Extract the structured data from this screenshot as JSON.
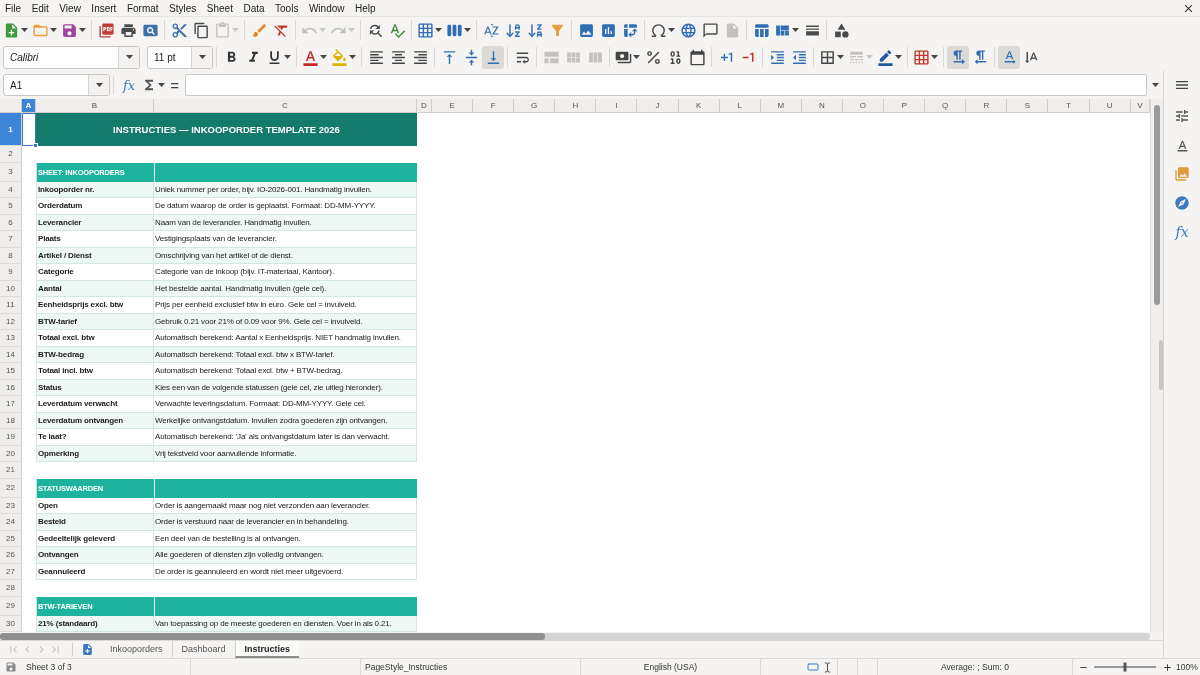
{
  "menu": [
    "File",
    "Edit",
    "View",
    "Insert",
    "Format",
    "Styles",
    "Sheet",
    "Data",
    "Tools",
    "Window",
    "Help"
  ],
  "toolbars": [
    {
      "groups": [
        [
          {
            "kind": "new",
            "disabled": false,
            "pressed": false,
            "dropdown": true
          },
          {
            "kind": "open",
            "disabled": false,
            "pressed": false,
            "dropdown": true
          },
          {
            "kind": "save",
            "disabled": false,
            "pressed": false,
            "dropdown": true
          }
        ],
        [
          {
            "kind": "pdf",
            "disabled": false,
            "pressed": false,
            "dropdown": false
          },
          {
            "kind": "print",
            "disabled": false,
            "pressed": false,
            "dropdown": false
          },
          {
            "kind": "preview",
            "disabled": false,
            "pressed": false,
            "dropdown": false
          }
        ],
        [
          {
            "kind": "cut",
            "disabled": false,
            "pressed": false,
            "dropdown": false
          },
          {
            "kind": "copy",
            "disabled": false,
            "pressed": false,
            "dropdown": false
          },
          {
            "kind": "paste",
            "disabled": true,
            "pressed": false,
            "dropdown": true
          }
        ],
        [
          {
            "kind": "clone",
            "disabled": false,
            "pressed": false,
            "dropdown": false
          },
          {
            "kind": "clear",
            "disabled": false,
            "pressed": false,
            "dropdown": false
          }
        ],
        [
          {
            "kind": "undo",
            "disabled": true,
            "pressed": false,
            "dropdown": true
          },
          {
            "kind": "redo",
            "disabled": true,
            "pressed": false,
            "dropdown": true
          }
        ],
        [
          {
            "kind": "find",
            "disabled": false,
            "pressed": false,
            "dropdown": false
          },
          {
            "kind": "spelling",
            "disabled": false,
            "pressed": false,
            "dropdown": false
          }
        ],
        [
          {
            "kind": "rows",
            "disabled": false,
            "pressed": false,
            "dropdown": true
          },
          {
            "kind": "columns",
            "disabled": false,
            "pressed": false,
            "dropdown": true
          }
        ],
        [
          {
            "kind": "sort",
            "disabled": false,
            "pressed": false,
            "dropdown": false
          },
          {
            "kind": "ascending",
            "disabled": false,
            "pressed": false,
            "dropdown": false
          },
          {
            "kind": "descending",
            "disabled": false,
            "pressed": false,
            "dropdown": false
          },
          {
            "kind": "filter",
            "disabled": false,
            "pressed": false,
            "dropdown": false
          }
        ],
        [
          {
            "kind": "image",
            "disabled": false,
            "pressed": false,
            "dropdown": false
          },
          {
            "kind": "chart",
            "disabled": false,
            "pressed": false,
            "dropdown": false
          },
          {
            "kind": "pivot",
            "disabled": false,
            "pressed": false,
            "dropdown": false
          }
        ],
        [
          {
            "kind": "symbol",
            "disabled": false,
            "pressed": false,
            "dropdown": true
          },
          {
            "kind": "hyperlink",
            "disabled": false,
            "pressed": false,
            "dropdown": false
          },
          {
            "kind": "comment",
            "disabled": false,
            "pressed": false,
            "dropdown": false
          },
          {
            "kind": "headerfooter",
            "disabled": true,
            "pressed": false,
            "dropdown": false
          }
        ],
        [
          {
            "kind": "printarea",
            "disabled": false,
            "pressed": false,
            "dropdown": false
          },
          {
            "kind": "freeze",
            "disabled": false,
            "pressed": false,
            "dropdown": true
          },
          {
            "kind": "split",
            "disabled": false,
            "pressed": false,
            "dropdown": false
          }
        ],
        [
          {
            "kind": "shapes",
            "disabled": false,
            "pressed": false,
            "dropdown": false
          }
        ]
      ]
    },
    {
      "font_name": "Calibri",
      "font_size": "11 pt",
      "groups": [
        [
          {
            "kind": "bold",
            "disabled": false,
            "pressed": false,
            "dropdown": false
          },
          {
            "kind": "italic",
            "disabled": false,
            "pressed": false,
            "dropdown": false
          },
          {
            "kind": "underline",
            "disabled": false,
            "pressed": false,
            "dropdown": true
          }
        ],
        [
          {
            "kind": "fontcolor",
            "disabled": false,
            "pressed": false,
            "dropdown": true
          },
          {
            "kind": "highlight",
            "disabled": false,
            "pressed": false,
            "dropdown": true
          }
        ],
        [
          {
            "kind": "left",
            "disabled": false,
            "pressed": false,
            "dropdown": false
          },
          {
            "kind": "center",
            "disabled": false,
            "pressed": false,
            "dropdown": false
          },
          {
            "kind": "right",
            "disabled": false,
            "pressed": false,
            "dropdown": false
          }
        ],
        [
          {
            "kind": "top",
            "disabled": false,
            "pressed": false,
            "dropdown": false
          },
          {
            "kind": "middle",
            "disabled": false,
            "pressed": false,
            "dropdown": false
          },
          {
            "kind": "bottom",
            "disabled": false,
            "pressed": true,
            "dropdown": false
          }
        ],
        [
          {
            "kind": "wrap",
            "disabled": false,
            "pressed": false,
            "dropdown": false
          }
        ],
        [
          {
            "kind": "merge",
            "disabled": true,
            "pressed": false,
            "dropdown": false
          },
          {
            "kind": "mergecells",
            "disabled": true,
            "pressed": false,
            "dropdown": false
          },
          {
            "kind": "unmerge",
            "disabled": true,
            "pressed": false,
            "dropdown": false
          }
        ],
        [
          {
            "kind": "currency",
            "disabled": false,
            "pressed": false,
            "dropdown": true
          },
          {
            "kind": "percent",
            "disabled": false,
            "pressed": false,
            "dropdown": false
          },
          {
            "kind": "number",
            "disabled": false,
            "pressed": false,
            "dropdown": false
          },
          {
            "kind": "date",
            "disabled": false,
            "pressed": false,
            "dropdown": false
          }
        ],
        [
          {
            "kind": "adddecimal",
            "disabled": false,
            "pressed": false,
            "dropdown": false
          },
          {
            "kind": "deletedecimal",
            "disabled": false,
            "pressed": false,
            "dropdown": false
          }
        ],
        [
          {
            "kind": "indent",
            "disabled": false,
            "pressed": false,
            "dropdown": false
          },
          {
            "kind": "outdent",
            "disabled": false,
            "pressed": false,
            "dropdown": false
          }
        ],
        [
          {
            "kind": "borders",
            "disabled": false,
            "pressed": false,
            "dropdown": true
          },
          {
            "kind": "borderstyle",
            "disabled": true,
            "pressed": false,
            "dropdown": true
          },
          {
            "kind": "bordercolor",
            "disabled": false,
            "pressed": false,
            "dropdown": true
          }
        ],
        [
          {
            "kind": "conditional",
            "disabled": false,
            "pressed": false,
            "dropdown": true
          }
        ],
        [
          {
            "kind": "ltr",
            "disabled": false,
            "pressed": true,
            "dropdown": false
          },
          {
            "kind": "rtl",
            "disabled": false,
            "pressed": false,
            "dropdown": false
          }
        ],
        [
          {
            "kind": "horizontal",
            "disabled": false,
            "pressed": true,
            "dropdown": false
          },
          {
            "kind": "vertical",
            "disabled": false,
            "pressed": false,
            "dropdown": false
          }
        ]
      ]
    }
  ],
  "formula_bar": {
    "name_box": "A1",
    "wizard": "fx",
    "equals": "="
  },
  "sheet": {
    "columns": [
      {
        "label": "A",
        "selected": true
      },
      {
        "label": "B",
        "selected": false
      },
      {
        "label": "C",
        "selected": false
      },
      {
        "label": "D",
        "selected": false
      },
      {
        "label": "E",
        "selected": false
      },
      {
        "label": "F",
        "selected": false
      },
      {
        "label": "G",
        "selected": false
      },
      {
        "label": "H",
        "selected": false
      },
      {
        "label": "I",
        "selected": false
      },
      {
        "label": "J",
        "selected": false
      },
      {
        "label": "K",
        "selected": false
      },
      {
        "label": "L",
        "selected": false
      },
      {
        "label": "M",
        "selected": false
      },
      {
        "label": "N",
        "selected": false
      },
      {
        "label": "O",
        "selected": false
      },
      {
        "label": "P",
        "selected": false
      },
      {
        "label": "Q",
        "selected": false
      },
      {
        "label": "R",
        "selected": false
      },
      {
        "label": "S",
        "selected": false
      },
      {
        "label": "T",
        "selected": false
      },
      {
        "label": "U",
        "selected": false
      },
      {
        "label": "V",
        "selected": false
      }
    ],
    "rows": [
      {
        "number": "1",
        "selected": true,
        "kind": "title",
        "cells": [
          "INSTRUCTIES — INKOOPORDER TEMPLATE 2026"
        ]
      },
      {
        "number": "2",
        "selected": false,
        "kind": "blank"
      },
      {
        "number": "3",
        "selected": false,
        "kind": "section",
        "cells": [
          "SHEET: INKOOPORDERS"
        ]
      },
      {
        "number": "4",
        "selected": false,
        "kind": "entry",
        "shaded": true,
        "cells": [
          "Inkooporder nr.",
          "Uniek nummer per order, bijv. IO-2026-001. Handmatig invullen."
        ]
      },
      {
        "number": "5",
        "selected": false,
        "kind": "entry",
        "shaded": false,
        "cells": [
          "Orderdatum",
          "De datum waarop de order is geplaatst. Formaat: DD-MM-YYYY."
        ]
      },
      {
        "number": "6",
        "selected": false,
        "kind": "entry",
        "shaded": true,
        "cells": [
          "Leverancier",
          "Naam van de leverancier. Handmatig invullen."
        ]
      },
      {
        "number": "7",
        "selected": false,
        "kind": "entry",
        "shaded": false,
        "cells": [
          "Plaats",
          "Vestigingsplaats van de leverancier."
        ]
      },
      {
        "number": "8",
        "selected": false,
        "kind": "entry",
        "shaded": true,
        "cells": [
          "Artikel / Dienst",
          "Omschrijving van het artikel of de dienst."
        ]
      },
      {
        "number": "9",
        "selected": false,
        "kind": "entry",
        "shaded": false,
        "cells": [
          "Categorie",
          "Categorie van de inkoop (bijv. IT-materiaal, Kantoor)."
        ]
      },
      {
        "number": "10",
        "selected": false,
        "kind": "entry",
        "shaded": true,
        "cells": [
          "Aantal",
          "Het bestelde aantal. Handmatig invullen (gele cel)."
        ]
      },
      {
        "number": "11",
        "selected": false,
        "kind": "entry",
        "shaded": false,
        "cells": [
          "Eenheidsprijs excl. btw",
          "Prijs per eenheid exclusief btw in euro. Gele cel = invulveld."
        ]
      },
      {
        "number": "12",
        "selected": false,
        "kind": "entry",
        "shaded": true,
        "cells": [
          "BTW-tarief",
          "Gebruik 0.21 voor 21% of 0.09 voor 9%. Gele cel = invulveld."
        ]
      },
      {
        "number": "13",
        "selected": false,
        "kind": "entry",
        "shaded": false,
        "cells": [
          "Totaal excl. btw",
          "Automatisch berekend: Aantal x Eenheidsprijs. NIET handmatig invullen."
        ]
      },
      {
        "number": "14",
        "selected": false,
        "kind": "entry",
        "shaded": true,
        "cells": [
          "BTW-bedrag",
          "Automatisch berekend: Totaal excl. btw x BTW-tarief."
        ]
      },
      {
        "number": "15",
        "selected": false,
        "kind": "entry",
        "shaded": false,
        "cells": [
          "Totaal incl. btw",
          "Automatisch berekend: Totaal excl. btw + BTW-bedrag."
        ]
      },
      {
        "number": "16",
        "selected": false,
        "kind": "entry",
        "shaded": true,
        "cells": [
          "Status",
          "Kies een van de volgende statussen (gele cel, zie uitleg hieronder)."
        ]
      },
      {
        "number": "17",
        "selected": false,
        "kind": "entry",
        "shaded": false,
        "cells": [
          "Leverdatum verwacht",
          "Verwachte leveringsdatum. Formaat: DD-MM-YYYY. Gele cel."
        ]
      },
      {
        "number": "18",
        "selected": false,
        "kind": "entry",
        "shaded": true,
        "cells": [
          "Leverdatum ontvangen",
          "Werkelijke ontvangstdatum. Invullen zodra goederen zijn ontvangen."
        ]
      },
      {
        "number": "19",
        "selected": false,
        "kind": "entry",
        "shaded": false,
        "cells": [
          "Te laat?",
          "Automatisch berekend: 'Ja' als ontvangstdatum later is dan verwacht."
        ]
      },
      {
        "number": "20",
        "selected": false,
        "kind": "entry",
        "shaded": true,
        "cells": [
          "Opmerking",
          "Vrij tekstveld voor aanvullende informatie."
        ]
      },
      {
        "number": "21",
        "selected": false,
        "kind": "blank"
      },
      {
        "number": "22",
        "selected": false,
        "kind": "section",
        "cells": [
          "STATUSWAARDEN"
        ]
      },
      {
        "number": "23",
        "selected": false,
        "kind": "entry",
        "shaded": false,
        "cells": [
          "Open",
          "Order is aangemaakt maar nog niet verzonden aan leverancier."
        ]
      },
      {
        "number": "24",
        "selected": false,
        "kind": "entry",
        "shaded": true,
        "cells": [
          "Besteld",
          "Order is verstuurd naar de leverancier en in behandeling."
        ]
      },
      {
        "number": "25",
        "selected": false,
        "kind": "entry",
        "shaded": false,
        "cells": [
          "Gedeeltelijk geleverd",
          "Een deel van de bestelling is al ontvangen."
        ]
      },
      {
        "number": "26",
        "selected": false,
        "kind": "entry",
        "shaded": true,
        "cells": [
          "Ontvangen",
          "Alle goederen of diensten zijn volledig ontvangen."
        ]
      },
      {
        "number": "27",
        "selected": false,
        "kind": "entry",
        "shaded": false,
        "cells": [
          "Geannuleerd",
          "De order is geannuleerd en wordt niet meer uitgevoerd."
        ]
      },
      {
        "number": "28",
        "selected": false,
        "kind": "blank"
      },
      {
        "number": "29",
        "selected": false,
        "kind": "section",
        "cells": [
          "BTW-TARIEVEN"
        ]
      },
      {
        "number": "30",
        "selected": false,
        "kind": "entry",
        "shaded": true,
        "cells": [
          "21% (standaard)",
          "Van toepassing op de meeste goederen en diensten. Voer in als 0.21."
        ]
      }
    ]
  },
  "sheet_nav": [
    {
      "kind": "first",
      "disabled": true
    },
    {
      "kind": "previous",
      "disabled": true
    },
    {
      "kind": "next",
      "disabled": true
    },
    {
      "kind": "last",
      "disabled": true
    }
  ],
  "sheet_tabs": [
    {
      "label": "Inkooporders",
      "selected": false
    },
    {
      "label": "Dashboard",
      "selected": false
    },
    {
      "label": "Instructies",
      "selected": true
    }
  ],
  "sidebar": {
    "functions_tab": "fx"
  },
  "status_bar": {
    "sheet": "Sheet 3 of 3",
    "page_style": "PageStyle_Instructies",
    "language": "English (USA)",
    "summary": "Average: ; Sum: 0",
    "zoom": {
      "level": 0.5,
      "reading": "100%"
    }
  }
}
